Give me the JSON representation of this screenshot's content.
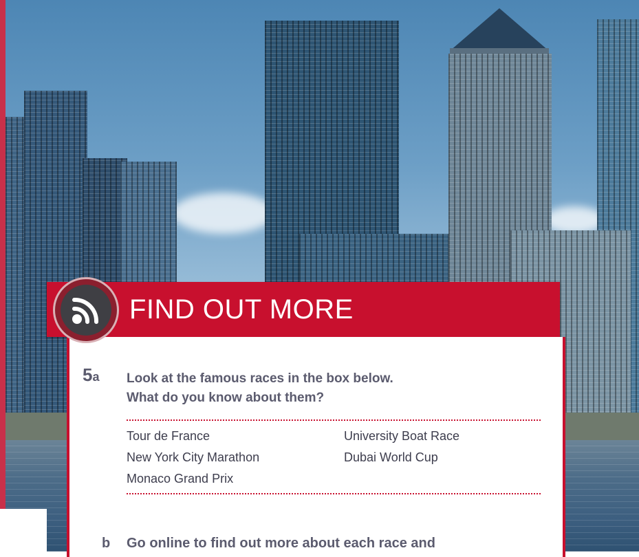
{
  "banner": {
    "title": "FIND OUT MORE",
    "icon": "wifi-signal-icon",
    "color": "#c8102e"
  },
  "exercise_a": {
    "number": "5",
    "letter": "a",
    "line1": "Look at the famous races in the box below.",
    "line2": "What do you know about them?"
  },
  "races": {
    "left": [
      "Tour de France",
      "New York City Marathon",
      "Monaco Grand Prix"
    ],
    "right": [
      "University Boat Race",
      "Dubai World Cup"
    ]
  },
  "exercise_b": {
    "letter": "b",
    "text": "Go online to find out more about each race and"
  }
}
